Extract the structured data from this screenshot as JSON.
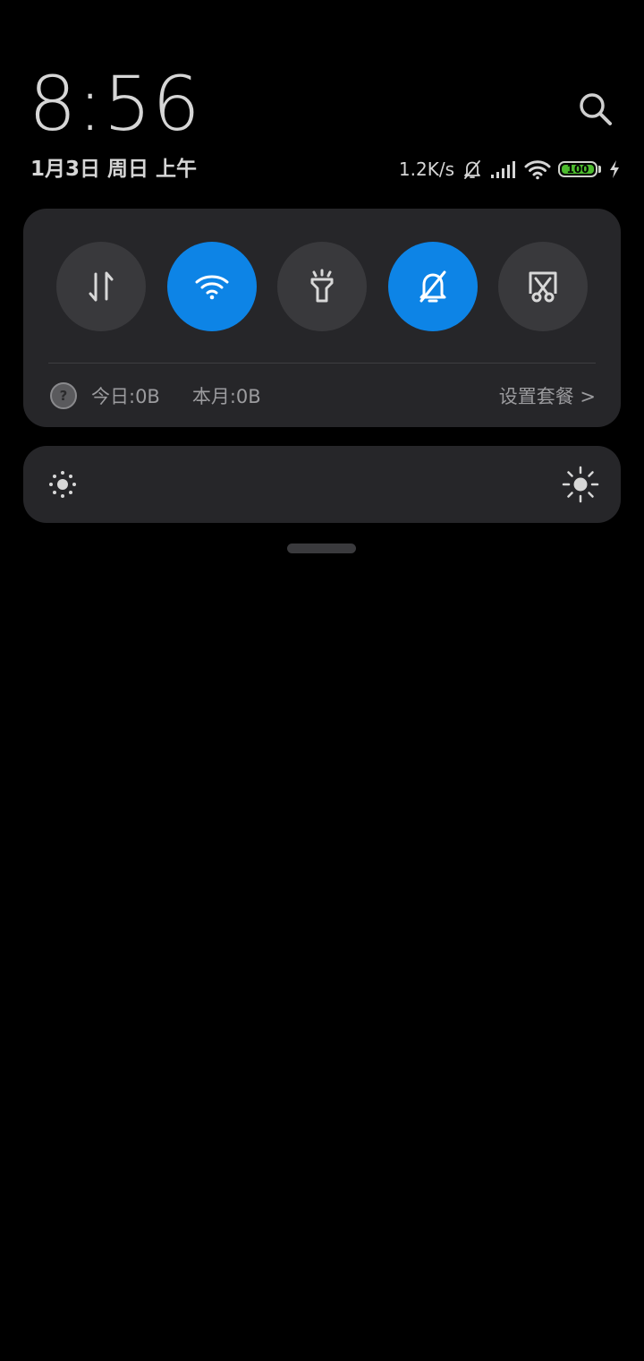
{
  "header": {
    "time": "8:56",
    "date": "1月3日 周日 上午",
    "search_icon": "search-icon"
  },
  "status_bar": {
    "net_speed": "1.2K/s",
    "icons": [
      "bell-muted-icon",
      "signal-icon",
      "wifi-icon",
      "battery-icon",
      "charging-icon"
    ],
    "battery_level": "100",
    "battery_color": "#4cbb2d"
  },
  "quick_toggles": {
    "items": [
      {
        "name": "mobile-data",
        "icon": "data-transfer-icon",
        "active": false
      },
      {
        "name": "wifi",
        "icon": "wifi-icon",
        "active": true
      },
      {
        "name": "flashlight",
        "icon": "flashlight-icon",
        "active": false
      },
      {
        "name": "silent",
        "icon": "bell-muted-icon",
        "active": true
      },
      {
        "name": "screenshot",
        "icon": "screenshot-scissors-icon",
        "active": false
      }
    ],
    "active_color": "#0d84e6",
    "inactive_color": "#39393c"
  },
  "data_usage": {
    "help_glyph": "?",
    "today": "今日:0B",
    "month": "本月:0B",
    "plan_link": "设置套餐 >"
  },
  "brightness": {
    "low_icon": "brightness-low-icon",
    "high_icon": "brightness-high-icon"
  }
}
